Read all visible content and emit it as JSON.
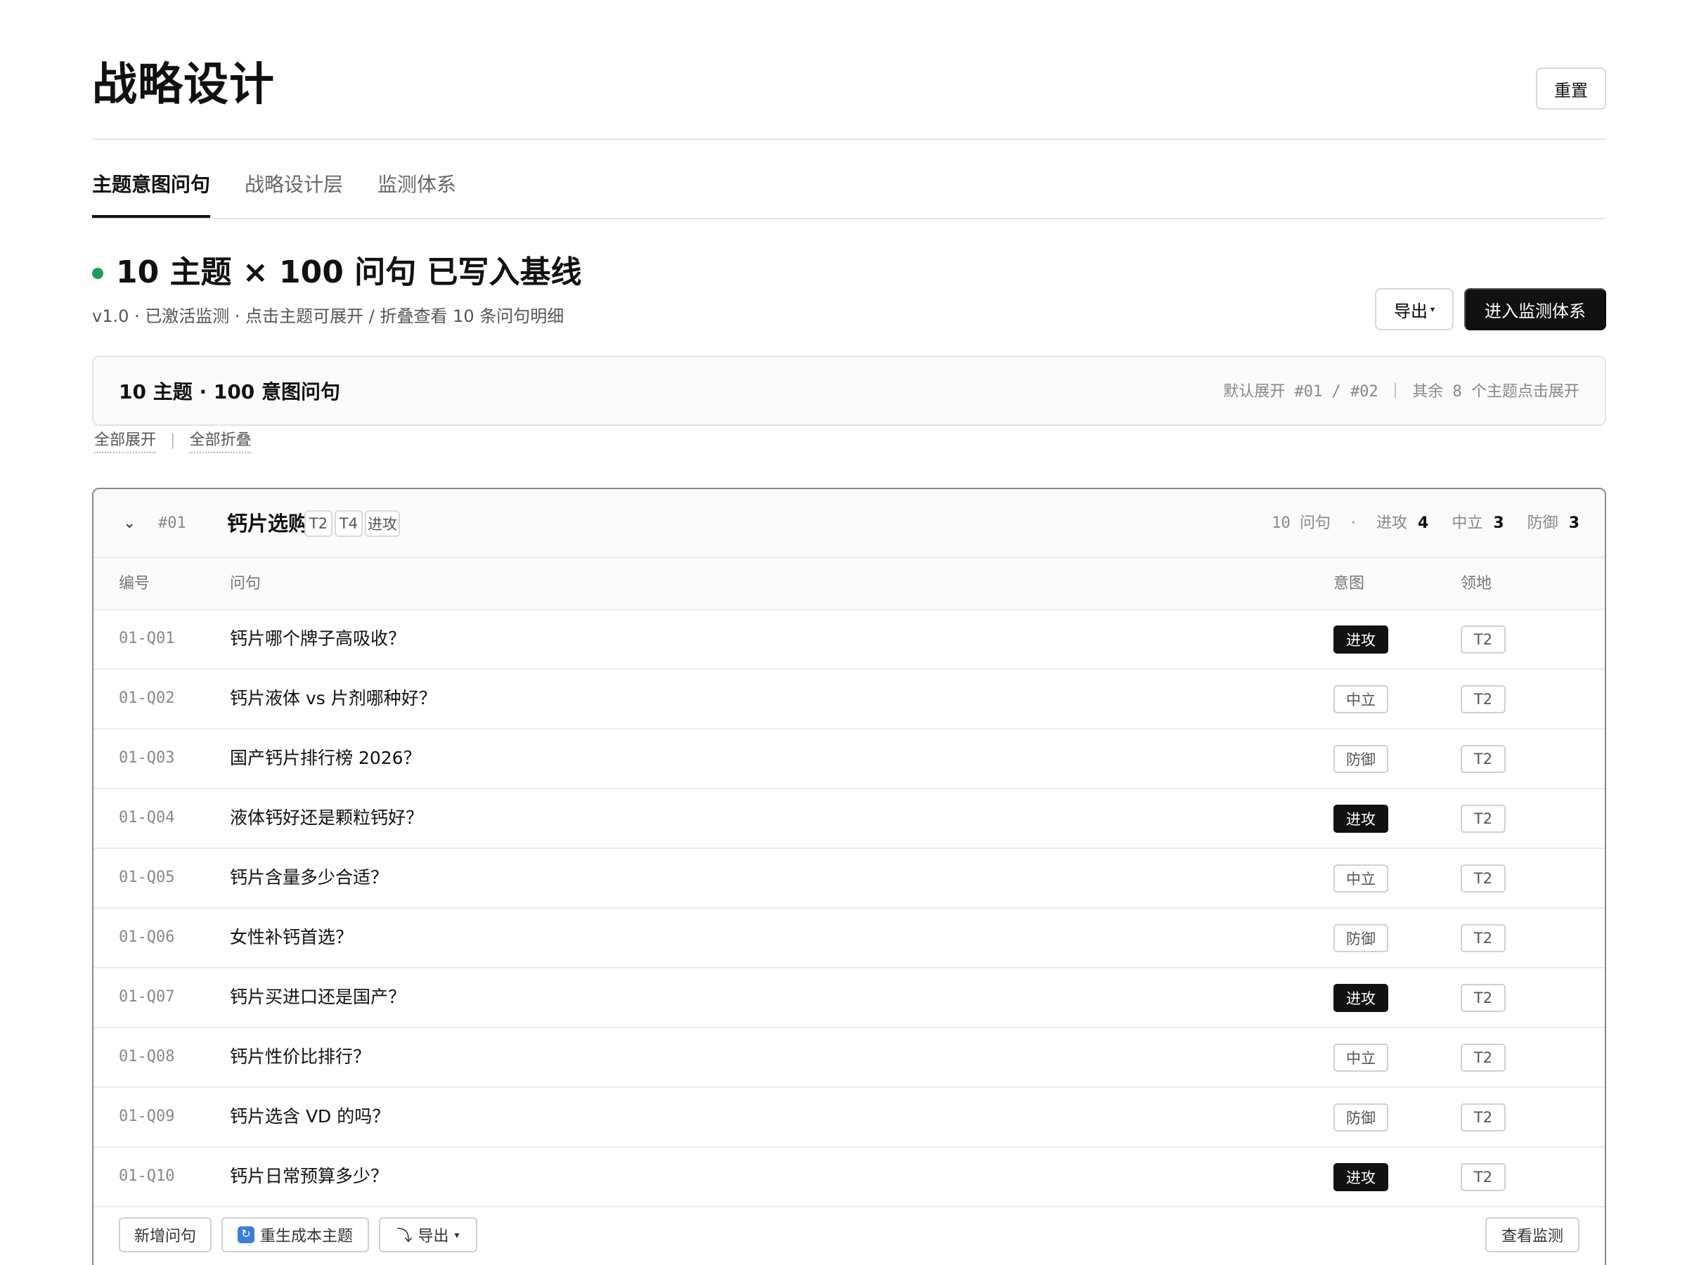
{
  "page": {
    "title": "战略设计",
    "reset_label": "重置"
  },
  "tabs": [
    {
      "label": "主题意图问句",
      "active": true
    },
    {
      "label": "战略设计层",
      "active": false
    },
    {
      "label": "监测体系",
      "active": false
    }
  ],
  "status": {
    "title": "10 主题 × 100 问句 已写入基线",
    "subtitle": "v1.0 · 已激活监测 · 点击主题可展开 / 折叠查看 10 条问句明细",
    "dot_color": "#1f9d55",
    "export_label": "导出",
    "primary_label": "进入监测体系"
  },
  "summary": {
    "title": "10 主题 · 100 意图问句",
    "hint": "默认展开 #01 / #02 ｜ 其余 8 个主题点击展开",
    "expand_all": "全部展开",
    "collapse_all": "全部折叠"
  },
  "topic": {
    "id": "#01",
    "name": "钙片选购",
    "tags": [
      "T2",
      "T4",
      "进攻"
    ],
    "count_label": "10 问句",
    "stats": {
      "attack_label": "进攻",
      "attack_count": "4",
      "neutral_label": "中立",
      "neutral_count": "3",
      "defense_label": "防御",
      "defense_count": "3"
    },
    "columns": {
      "id": "编号",
      "question": "问句",
      "intent": "意图",
      "territory": "领地"
    },
    "rows": [
      {
        "id": "01-Q01",
        "question": "钙片哪个牌子高吸收？",
        "intent": "进攻",
        "territory": "T2"
      },
      {
        "id": "01-Q02",
        "question": "钙片液体 vs 片剂哪种好？",
        "intent": "中立",
        "territory": "T2"
      },
      {
        "id": "01-Q03",
        "question": "国产钙片排行榜 2026？",
        "intent": "防御",
        "territory": "T2"
      },
      {
        "id": "01-Q04",
        "question": "液体钙好还是颗粒钙好？",
        "intent": "进攻",
        "territory": "T2"
      },
      {
        "id": "01-Q05",
        "question": "钙片含量多少合适？",
        "intent": "中立",
        "territory": "T2"
      },
      {
        "id": "01-Q06",
        "question": "女性补钙首选？",
        "intent": "防御",
        "territory": "T2"
      },
      {
        "id": "01-Q07",
        "question": "钙片买进口还是国产？",
        "intent": "进攻",
        "territory": "T2"
      },
      {
        "id": "01-Q08",
        "question": "钙片性价比排行？",
        "intent": "中立",
        "territory": "T2"
      },
      {
        "id": "01-Q09",
        "question": "钙片选含 VD 的吗？",
        "intent": "防御",
        "territory": "T2"
      },
      {
        "id": "01-Q10",
        "question": "钙片日常预算多少？",
        "intent": "进攻",
        "territory": "T2"
      }
    ],
    "footer": {
      "add_label": "新增问句",
      "regen_label": "重生成本主题",
      "export_label": "导出",
      "view_label": "查看监测"
    }
  },
  "icons": {
    "chevron": "chevron-down-icon",
    "refresh": "refresh-icon",
    "export_arrow": "export-arrow-icon"
  }
}
